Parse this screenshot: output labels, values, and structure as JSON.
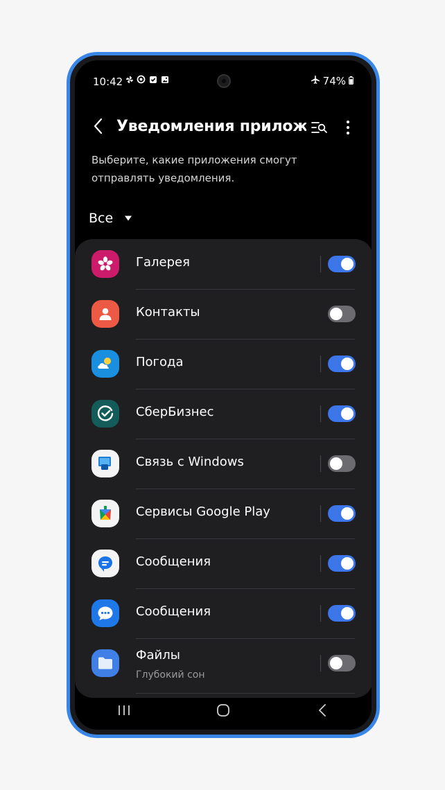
{
  "status": {
    "time": "10:42",
    "battery": "74%"
  },
  "header": {
    "title": "Уведомления прилож...",
    "description": "Выберите, какие приложения смогут отправлять уведомления."
  },
  "filter": {
    "selected": "Все"
  },
  "apps": [
    {
      "name": "Галерея",
      "enabled": true,
      "icon": "gallery-icon"
    },
    {
      "name": "Контакты",
      "enabled": false,
      "icon": "contacts-icon"
    },
    {
      "name": "Погода",
      "enabled": true,
      "icon": "weather-icon"
    },
    {
      "name": "СберБизнес",
      "enabled": true,
      "icon": "sberbusiness-icon"
    },
    {
      "name": "Связь с Windows",
      "enabled": false,
      "icon": "link-to-windows-icon"
    },
    {
      "name": "Сервисы Google Play",
      "enabled": true,
      "icon": "google-play-services-icon"
    },
    {
      "name": "Сообщения",
      "enabled": true,
      "icon": "google-messages-icon"
    },
    {
      "name": "Сообщения",
      "enabled": true,
      "icon": "samsung-messages-icon"
    },
    {
      "name": "Файлы",
      "subtitle": "Глубокий сон",
      "enabled": false,
      "icon": "files-icon"
    }
  ],
  "colors": {
    "accent": "#3c76e8",
    "background": "#000000",
    "card": "#1f1f22",
    "frame": "#3a86e6"
  }
}
